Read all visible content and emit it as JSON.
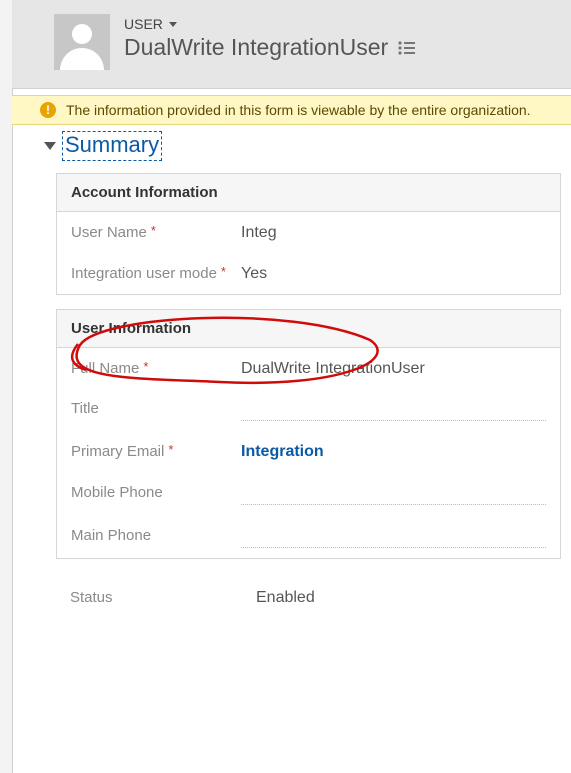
{
  "header": {
    "type_label": "USER",
    "title": "DualWrite IntegrationUser"
  },
  "notice": {
    "text": "The information provided in this form is viewable by the entire organization."
  },
  "section": {
    "summary_label": "Summary"
  },
  "account_info": {
    "heading": "Account Information",
    "username_label": "User Name",
    "username_value": "Integ",
    "integration_mode_label": "Integration user mode",
    "integration_mode_value": "Yes"
  },
  "user_info": {
    "heading": "User Information",
    "fullname_label": "Full Name",
    "fullname_value": "DualWrite IntegrationUser",
    "title_label": "Title",
    "title_value": "",
    "email_label": "Primary Email",
    "email_value": "Integration",
    "mobile_label": "Mobile Phone",
    "mobile_value": "",
    "mainphone_label": "Main Phone",
    "mainphone_value": ""
  },
  "status": {
    "label": "Status",
    "value": "Enabled"
  }
}
